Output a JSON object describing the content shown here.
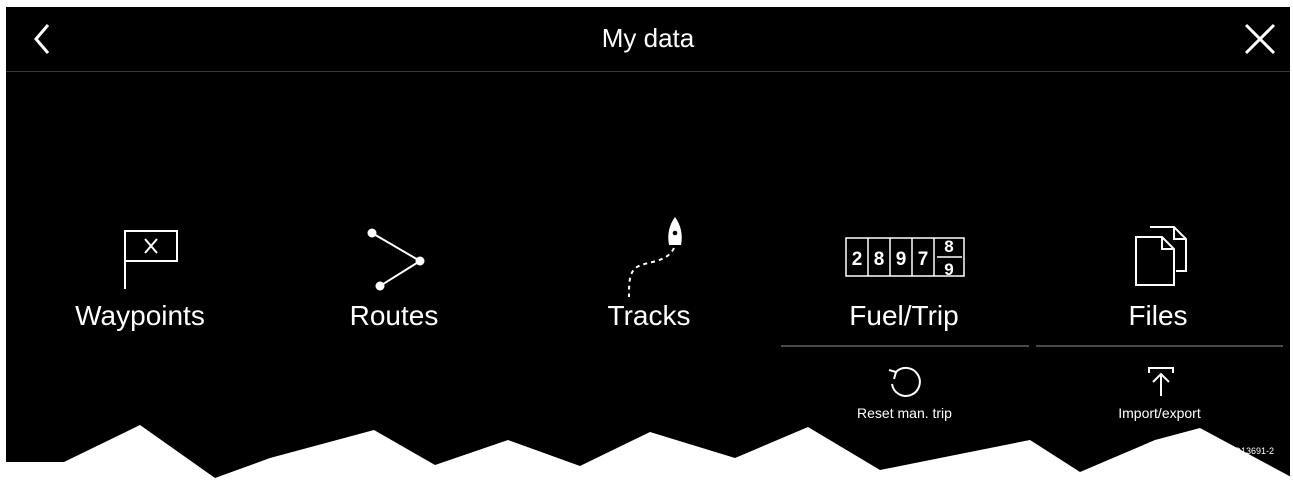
{
  "header": {
    "title": "My data",
    "back_icon": "chevron-left-icon",
    "close_icon": "close-icon"
  },
  "tiles": [
    {
      "label": "Waypoints",
      "icon": "waypoint-flag-icon"
    },
    {
      "label": "Routes",
      "icon": "route-icon"
    },
    {
      "label": "Tracks",
      "icon": "track-boat-icon"
    },
    {
      "label": "Fuel/Trip",
      "icon": "odometer-icon",
      "odometer_digits": [
        "2",
        "8",
        "9",
        "7"
      ],
      "odometer_roll": [
        "8",
        "9"
      ]
    },
    {
      "label": "Files",
      "icon": "files-icon"
    }
  ],
  "sub_actions": [
    {
      "label": "Reset man. trip",
      "icon": "reset-icon"
    },
    {
      "label": "Import/export",
      "icon": "upload-icon"
    }
  ],
  "figure_ref": "D13691-2",
  "colors": {
    "background": "#000000",
    "text": "#ffffff",
    "divider": "#4a4a4a"
  }
}
